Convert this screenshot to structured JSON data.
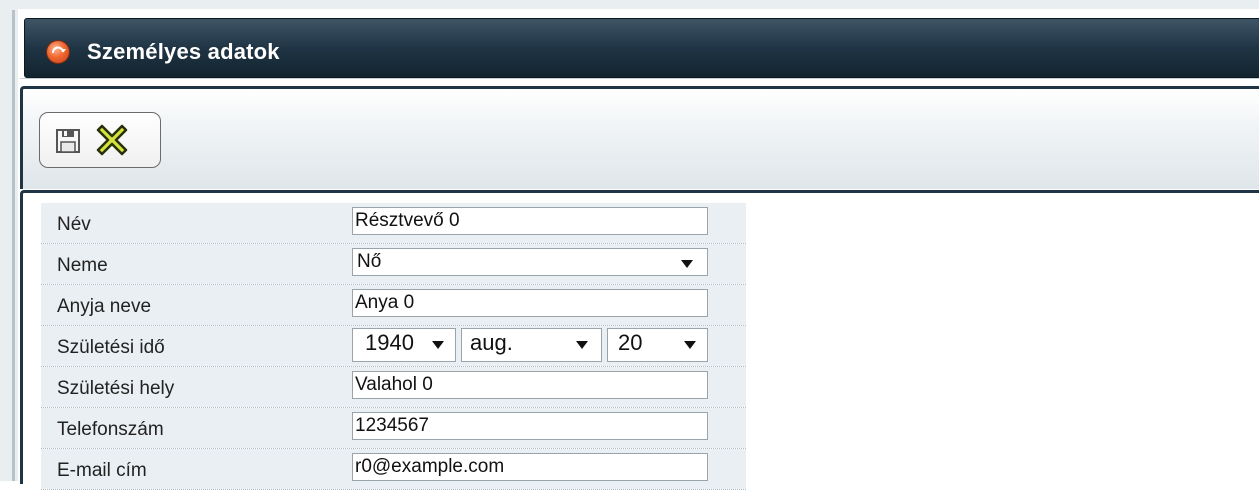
{
  "window": {
    "title": "Személyes adatok",
    "title_icon": "app-icon"
  },
  "toolbar": {
    "save_icon": "save-icon",
    "cancel_icon": "cancel-x-icon"
  },
  "form": {
    "name": {
      "label": "Név",
      "value": "Résztvevő 0"
    },
    "gender": {
      "label": "Neme",
      "value": "Nő"
    },
    "mother_name": {
      "label": "Anyja neve",
      "value": "Anya 0"
    },
    "birth_date": {
      "label": "Születési idő",
      "year": "1940",
      "month": "aug.",
      "day": "20"
    },
    "birth_place": {
      "label": "Születési hely",
      "value": "Valahol 0"
    },
    "phone": {
      "label": "Telefonszám",
      "value": "1234567"
    },
    "email": {
      "label": "E-mail cím",
      "value": "r0@example.com"
    }
  },
  "colors": {
    "title_bar": "#1f3444",
    "row_background": "#e9eff3",
    "accent_icon": "#f0672f"
  }
}
